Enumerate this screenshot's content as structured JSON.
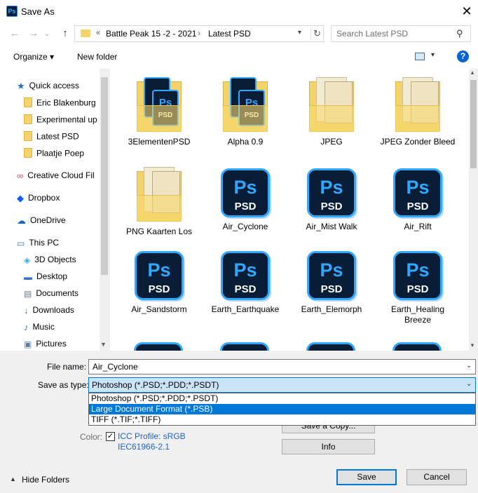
{
  "window": {
    "title": "Save As",
    "app_icon_text": "Ps",
    "close_glyph": "✕"
  },
  "nav": {
    "back": "←",
    "forward": "→",
    "dropdown": "⌄",
    "up": "↑"
  },
  "address": {
    "overflow": "«",
    "crumbs": [
      "Battle Peak 15 -2 - 2021",
      "Latest PSD"
    ],
    "separator": "›",
    "refresh": "↻"
  },
  "search": {
    "placeholder": "Search Latest PSD"
  },
  "toolbar": {
    "organize": "Organize ▾",
    "new_folder": "New folder",
    "help": "?"
  },
  "sidebar": {
    "items": [
      {
        "label": "Quick access",
        "icon": "star-icon"
      },
      {
        "label": "Eric Blakenburg",
        "icon": "folder-icon"
      },
      {
        "label": "Experimental up",
        "icon": "folder-icon"
      },
      {
        "label": "Latest PSD",
        "icon": "folder-icon"
      },
      {
        "label": "Plaatje Poep",
        "icon": "folder-icon"
      },
      {
        "label": "Creative Cloud Fil",
        "icon": "creative-cloud-icon"
      },
      {
        "label": "Dropbox",
        "icon": "dropbox-icon"
      },
      {
        "label": "OneDrive",
        "icon": "onedrive-icon"
      },
      {
        "label": "This PC",
        "icon": "pc-icon"
      },
      {
        "label": "3D Objects",
        "icon": "cube-icon"
      },
      {
        "label": "Desktop",
        "icon": "desktop-icon"
      },
      {
        "label": "Documents",
        "icon": "document-icon"
      },
      {
        "label": "Downloads",
        "icon": "download-icon"
      },
      {
        "label": "Music",
        "icon": "music-icon"
      },
      {
        "label": "Pictures",
        "icon": "pictures-icon"
      }
    ]
  },
  "files": [
    {
      "name": "3ElementenPSD",
      "kind": "folder-psd"
    },
    {
      "name": "Alpha 0.9",
      "kind": "folder-psd"
    },
    {
      "name": "JPEG",
      "kind": "folder-paper"
    },
    {
      "name": "JPEG Zonder Bleed",
      "kind": "folder-paper"
    },
    {
      "name": "PNG Kaarten Los",
      "kind": "folder-paper"
    },
    {
      "name": "Air_Cyclone",
      "kind": "psd"
    },
    {
      "name": "Air_Mist Walk",
      "kind": "psd"
    },
    {
      "name": "Air_Rift",
      "kind": "psd"
    },
    {
      "name": "Air_Sandstorm",
      "kind": "psd"
    },
    {
      "name": "Earth_Earthquake",
      "kind": "psd"
    },
    {
      "name": "Earth_Elemorph",
      "kind": "psd"
    },
    {
      "name": "Earth_Healing Breeze",
      "kind": "psd"
    }
  ],
  "psd_icon": {
    "ps": "Ps",
    "label": "PSD"
  },
  "form": {
    "file_name_label": "File name:",
    "file_name_value": "Air_Cyclone",
    "save_as_type_label": "Save as type:",
    "save_as_type_value": "Photoshop (*.PSD;*.PDD;*.PSDT)",
    "type_options": [
      "Photoshop (*.PSD;*.PDD;*.PSDT)",
      "Large Document Format (*.PSB)",
      "TIFF (*.TIF;*.TIFF)"
    ],
    "save_copy_label": "Save a Copy...",
    "info_label": "Info",
    "color_label": "Color:",
    "icc_line1": "ICC Profile:  sRGB",
    "icc_line2": "IEC61966-2.1",
    "check_glyph": "✓"
  },
  "footer": {
    "hide_folders": "Hide Folders",
    "save": "Save",
    "cancel": "Cancel"
  }
}
